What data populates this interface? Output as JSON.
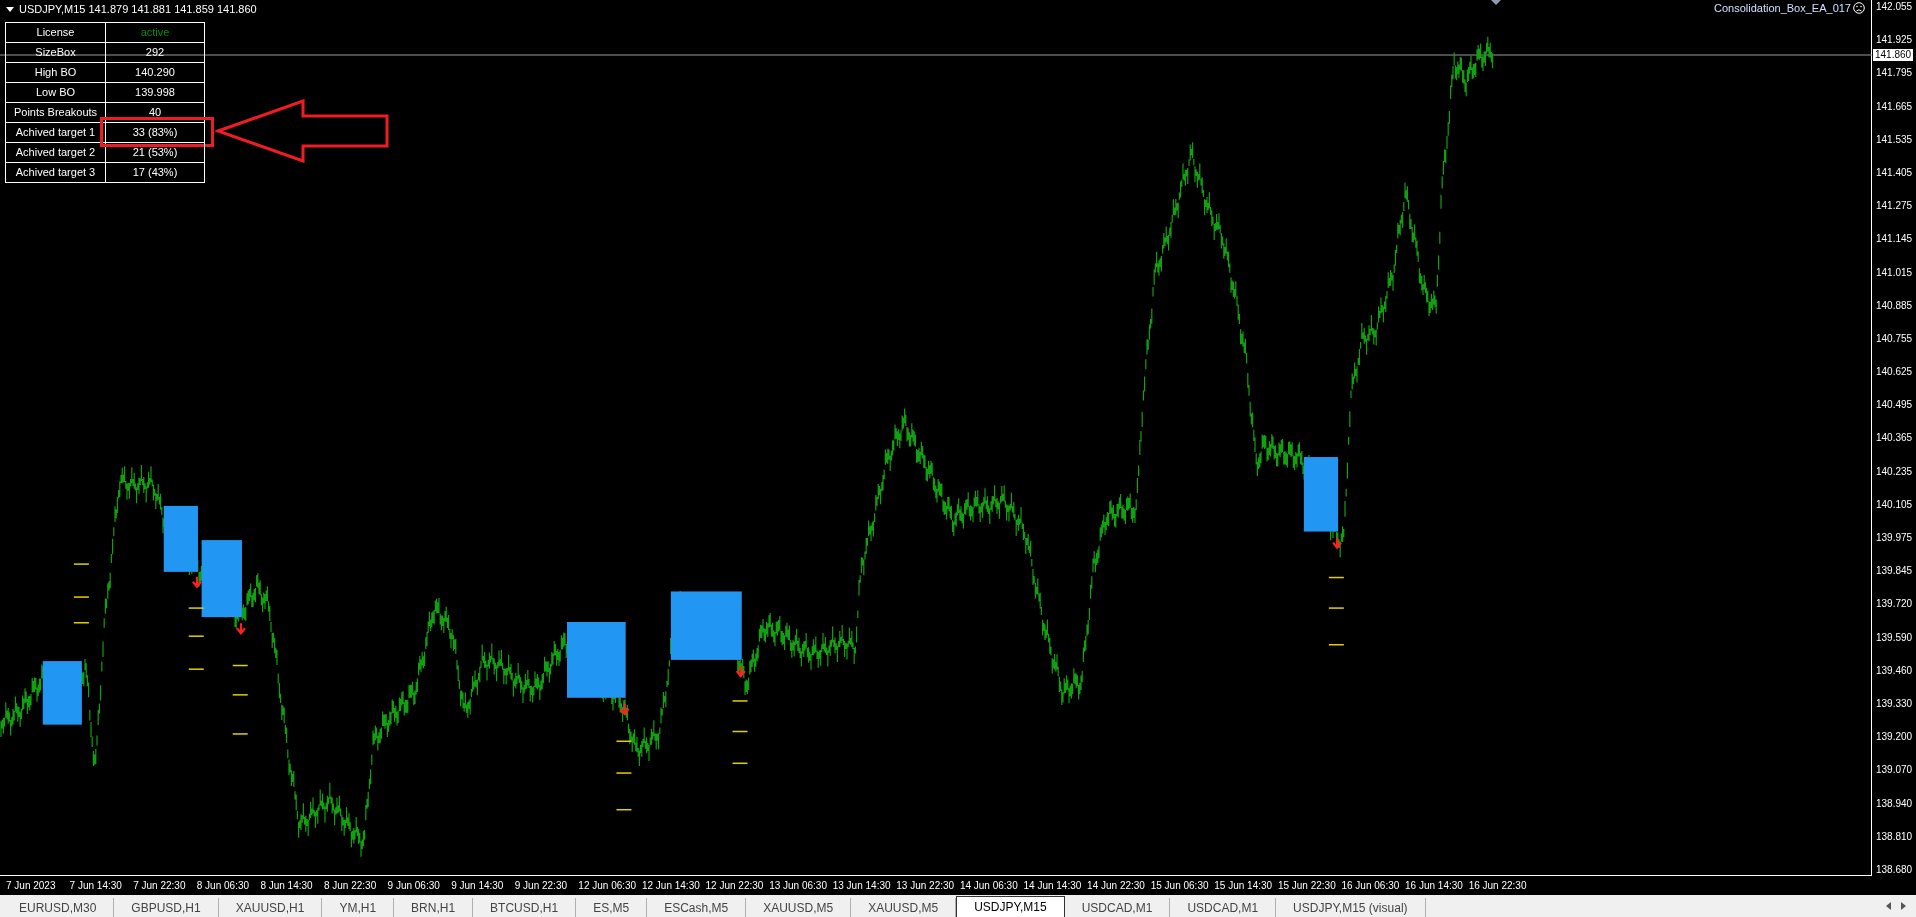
{
  "chart": {
    "header": "USDJPY,M15  141.879 141.881 141.859 141.860",
    "expert_label": "Consolidation_Box_EA_017",
    "info_table": [
      {
        "label": "License",
        "value": "active",
        "kind": "status",
        "highlighted": false
      },
      {
        "label": "SizeBox",
        "value": "292",
        "kind": "number",
        "highlighted": false
      },
      {
        "label": "High BO",
        "value": "140.290",
        "kind": "number",
        "highlighted": false
      },
      {
        "label": "Low BO",
        "value": "139.998",
        "kind": "number",
        "highlighted": false
      },
      {
        "label": "Points Breakouts",
        "value": "40",
        "kind": "number",
        "highlighted": false
      },
      {
        "label": "Achived target 1",
        "value": "33 (83%)",
        "kind": "number",
        "highlighted": true
      },
      {
        "label": "Achived target 2",
        "value": "21 (53%)",
        "kind": "number",
        "highlighted": false
      },
      {
        "label": "Achived target 3",
        "value": "17 (43%)",
        "kind": "number",
        "highlighted": false
      }
    ],
    "price_axis": {
      "labels": [
        "142.055",
        "141.925",
        "141.795",
        "141.665",
        "141.535",
        "141.405",
        "141.275",
        "141.145",
        "141.015",
        "140.885",
        "140.755",
        "140.625",
        "140.495",
        "140.365",
        "140.235",
        "140.105",
        "139.975",
        "139.845",
        "139.720",
        "139.590",
        "139.460",
        "139.330",
        "139.200",
        "139.070",
        "138.940",
        "138.810",
        "138.680"
      ],
      "current_price": "141.860"
    },
    "time_axis": {
      "labels": [
        "7 Jun 2023",
        "7 Jun 14:30",
        "7 Jun 22:30",
        "8 Jun 06:30",
        "8 Jun 14:30",
        "8 Jun 22:30",
        "9 Jun 06:30",
        "9 Jun 14:30",
        "9 Jun 22:30",
        "12 Jun 06:30",
        "12 Jun 14:30",
        "12 Jun 22:30",
        "13 Jun 06:30",
        "13 Jun 14:30",
        "13 Jun 22:30",
        "14 Jun 06:30",
        "14 Jun 14:30",
        "14 Jun 22:30",
        "15 Jun 06:30",
        "15 Jun 14:30",
        "15 Jun 22:30",
        "16 Jun 06:30",
        "16 Jun 14:30",
        "16 Jun 22:30"
      ]
    }
  },
  "tabs": [
    {
      "label": "EURUSD,M30",
      "selected": false
    },
    {
      "label": "GBPUSD,H1",
      "selected": false
    },
    {
      "label": "XAUUSD,H1",
      "selected": false
    },
    {
      "label": "YM,H1",
      "selected": false
    },
    {
      "label": "BRN,H1",
      "selected": false
    },
    {
      "label": "BTCUSD,H1",
      "selected": false
    },
    {
      "label": "ES,M5",
      "selected": false
    },
    {
      "label": "ESCash,M5",
      "selected": false
    },
    {
      "label": "XAUUSD,M5",
      "selected": false
    },
    {
      "label": "XAUUSD,M5",
      "selected": false
    },
    {
      "label": "USDJPY,M15",
      "selected": true
    },
    {
      "label": "USDCAD,M1",
      "selected": false
    },
    {
      "label": "USDCAD,M1",
      "selected": false
    },
    {
      "label": "USDJPY,M15 (visual)",
      "selected": false
    }
  ]
}
